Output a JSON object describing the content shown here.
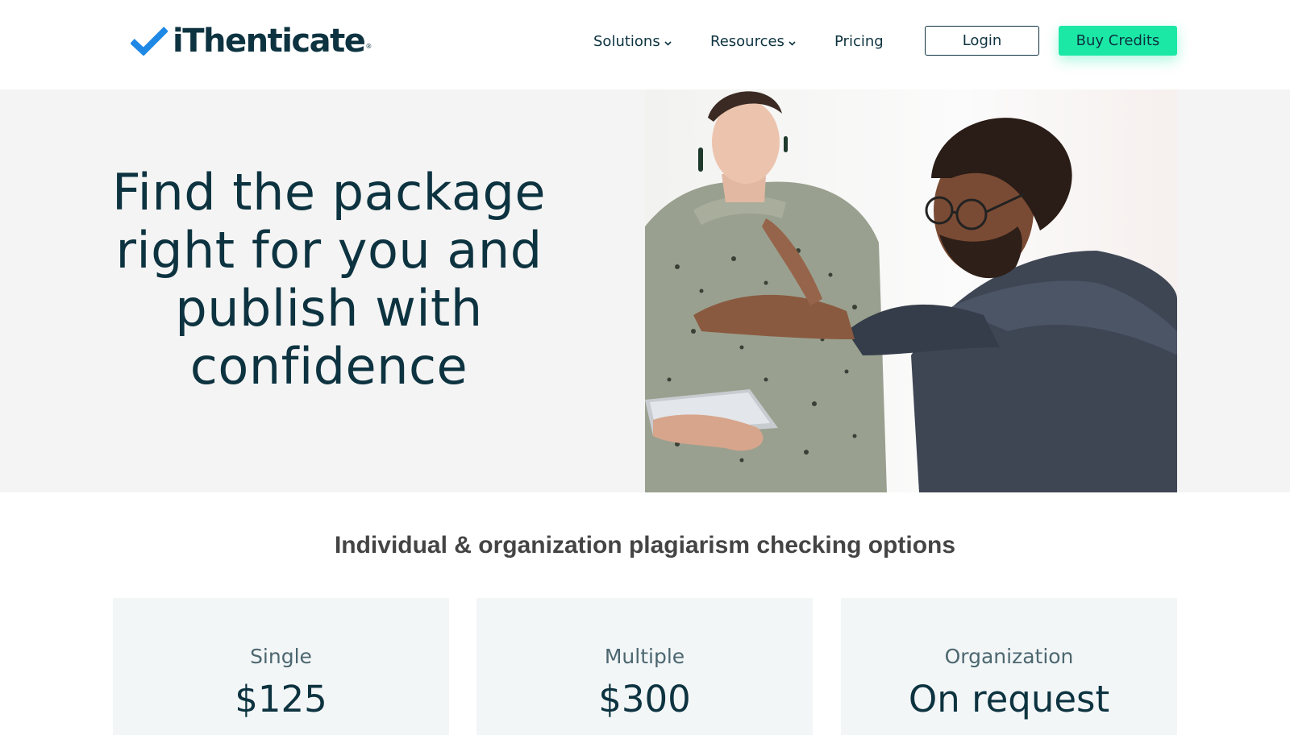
{
  "header": {
    "logo_text": "iThenticate",
    "logo_mark": "®",
    "nav": [
      {
        "label": "Solutions",
        "has_dropdown": true
      },
      {
        "label": "Resources",
        "has_dropdown": true
      },
      {
        "label": "Pricing",
        "has_dropdown": false
      }
    ],
    "login_label": "Login",
    "buy_label": "Buy Credits"
  },
  "hero": {
    "title_lines": [
      "Find the package",
      "right for you and",
      "publish with",
      "confidence"
    ],
    "image": "photo-two-people-with-tablet"
  },
  "section": {
    "heading": "Individual & organization plagiarism checking options"
  },
  "plans": [
    {
      "name": "Single",
      "price": "$125"
    },
    {
      "name": "Multiple",
      "price": "$300"
    },
    {
      "name": "Organization",
      "price": "On request"
    }
  ],
  "colors": {
    "brand_dark": "#0d3340",
    "check_blue": "#1e88e5",
    "accent_green": "#1ce8a6",
    "hero_bg": "#f4f4f4",
    "card_bg": "#f3f6f7"
  },
  "icons": {
    "logo": "checkmark-icon",
    "dropdown": "chevron-down-icon"
  }
}
